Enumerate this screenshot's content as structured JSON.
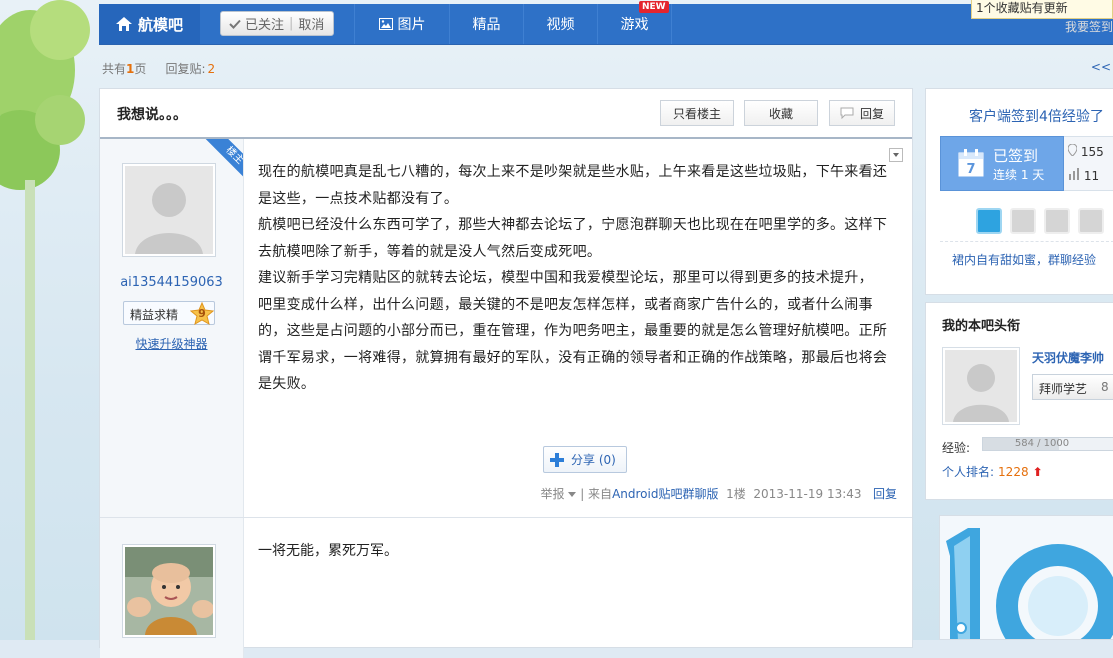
{
  "nav": {
    "forum_name": "航模吧",
    "follow_label": "已关注",
    "unfollow_label": "取消",
    "tabs": [
      "图片",
      "精品",
      "视频",
      "游戏"
    ],
    "new_badge": "NEW",
    "top_right_text": "我要签到",
    "favorites_tip": "1个收藏贴有更新"
  },
  "pageinfo": {
    "total_prefix": "共有",
    "total_pages": "1",
    "total_suffix": "页",
    "reply_label": "回复贴:",
    "reply_count": "2",
    "prev_link": "<<"
  },
  "thread": {
    "title": "我想说。。。",
    "only_op_label": "只看楼主",
    "favorite_label": "收藏",
    "reply_label": "回复"
  },
  "post1": {
    "op_badge": "楼主",
    "username": "ai13544159063",
    "title_badge": "精益求精",
    "level": "9",
    "upgrade_link": "快速升级神器",
    "paragraphs": [
      "现在的航模吧真是乱七八糟的，每次上来不是吵架就是些水贴，上午来看是这些垃圾贴，下午来看还是这些，一点技术贴都没有了。",
      "航模吧已经没什么东西可学了，那些大神都去论坛了，宁愿泡群聊天也比现在在吧里学的多。这样下去航模吧除了新手，等着的就是没人气然后变成死吧。",
      "建议新手学习完精贴区的就转去论坛，模型中国和我爱模型论坛，那里可以得到更多的技术提升，",
      "吧里变成什么样，出什么问题，最关键的不是吧友怎样怎样，或者商家广告什么的，或者什么闹事的，这些是占问题的小部分而已，重在管理，作为吧务吧主，最重要的就是怎么管理好航模吧。正所谓千军易求，一将难得，就算拥有最好的军队，没有正确的领导者和正确的作战策略，那最后也将会是失败。"
    ],
    "share_label": "分享 (0)",
    "report_label": "举报",
    "from_label": "来自",
    "client_name": "Android贴吧群聊版",
    "floor": "1楼",
    "timestamp": "2013-11-19 13:43",
    "reply_link": "回复"
  },
  "post2": {
    "text": "一将无能，累死万军。"
  },
  "sidebar": {
    "sign_promo": "客户端签到4倍经验了",
    "signed_label": "已签到",
    "streak_label": "连续 1 天",
    "calendar_day": "7",
    "stat1": "155",
    "stat2": "11",
    "tip": "裙内自有甜如蜜，群聊经验",
    "head_title": "我的本吧头衔",
    "head_name": "天羽伏魔李帅",
    "apprentice_label": "拜师学艺",
    "apprentice_num": "8",
    "exp_label": "经验:",
    "exp_text": "584 / 1000",
    "exp_fraction": 0.584,
    "rank_label": "个人排名:",
    "rank_value": "1228",
    "rank_arrow": "⬆"
  },
  "colors": {
    "nav_bg": "#2e71c7",
    "link": "#2d64b3",
    "accent_orange": "#e5700d"
  }
}
